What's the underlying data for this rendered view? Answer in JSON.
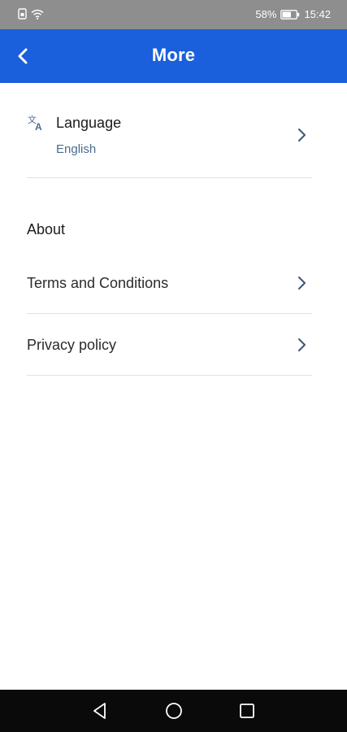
{
  "status_bar": {
    "battery": "58%",
    "time": "15:42",
    "icons": [
      "sim-icon",
      "wifi-icon",
      "battery-icon"
    ]
  },
  "app_bar": {
    "title": "More",
    "back_icon": "back-arrow-icon",
    "background": "#1a5fdb"
  },
  "language": {
    "title": "Language",
    "value": "English",
    "icon": "translate-icon"
  },
  "about": {
    "header": "About",
    "items": [
      {
        "label": "Terms and Conditions",
        "icon": "chevron-right-icon"
      },
      {
        "label": "Privacy policy",
        "icon": "chevron-right-icon"
      }
    ]
  },
  "nav_bar": {
    "buttons": [
      "back-triangle-icon",
      "home-circle-icon",
      "recents-square-icon"
    ]
  }
}
